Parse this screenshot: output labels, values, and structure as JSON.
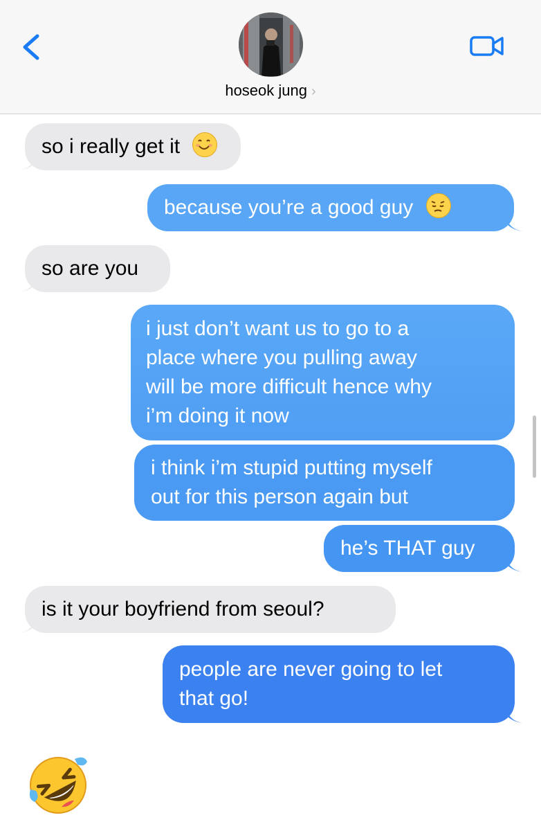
{
  "header": {
    "contact_name": "hoseok jung",
    "chevron": "›"
  },
  "icons": {
    "back": "back-chevron-icon",
    "video": "video-camera-icon",
    "smile": "smiling-face-emoji",
    "pensive": "pensive-face-emoji",
    "laugh": "rolling-on-floor-laughing-emoji"
  },
  "colors": {
    "sent_top": "#58a6f5",
    "sent_bottom": "#3b82f0",
    "received": "#e9e9eb",
    "ios_blue": "#1a7cf5"
  },
  "messages": [
    {
      "side": "received",
      "text": "so i really get it"
    },
    {
      "side": "sent",
      "text": "because you’re a good guy"
    },
    {
      "side": "received",
      "text": "so are you"
    },
    {
      "side": "sent",
      "lines": [
        "i just don’t want us to go to a",
        "place where you pulling away",
        "will be more difficult hence why",
        "i’m doing it now"
      ]
    },
    {
      "side": "sent",
      "lines": [
        "i think i’m stupid putting myself",
        "out for this person again but"
      ]
    },
    {
      "side": "sent",
      "text": "he’s THAT guy"
    },
    {
      "side": "received",
      "text": "is it your boyfriend from seoul?"
    },
    {
      "side": "sent",
      "lines": [
        "people are never going to let",
        "that go!"
      ]
    }
  ]
}
